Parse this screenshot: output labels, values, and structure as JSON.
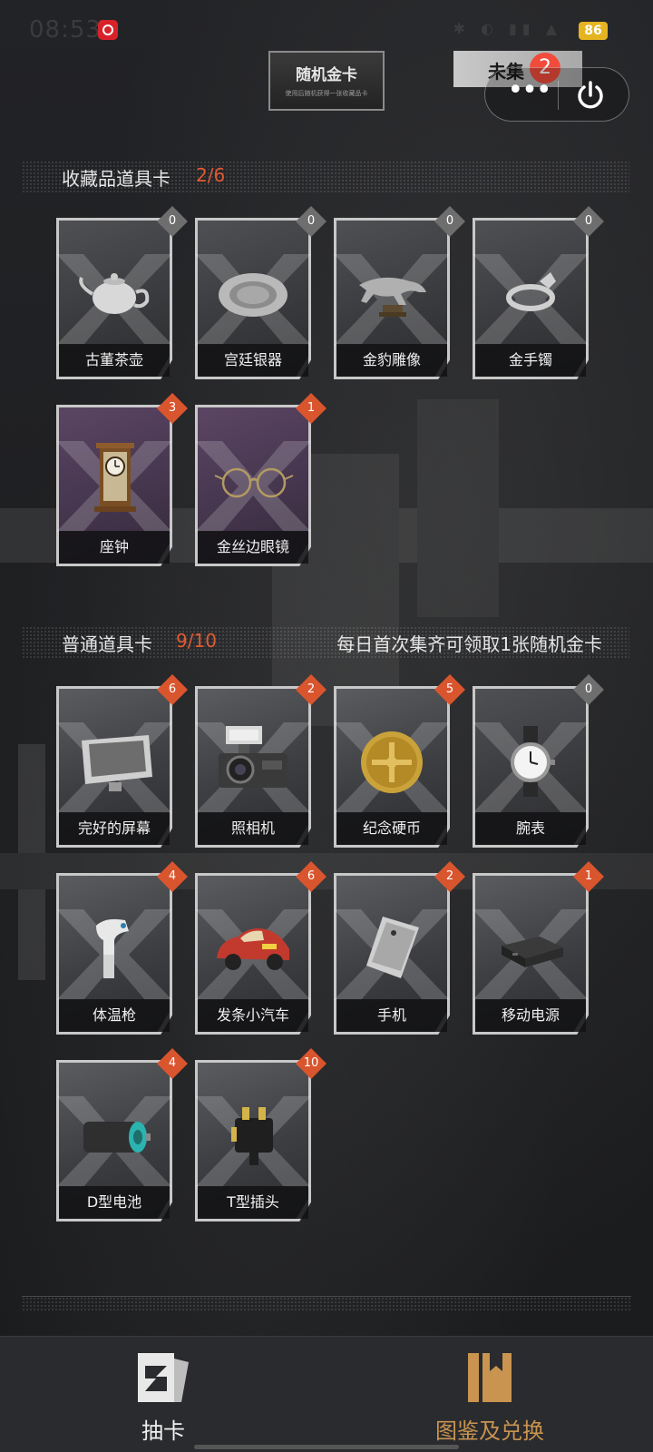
{
  "status_bar": {
    "time": "08:53",
    "battery": "86"
  },
  "top": {
    "gold_card_title": "随机金卡",
    "gold_card_subtitle": "使用后随机获得一张收藏品卡",
    "uncollected_tab": "未集",
    "uncollected_badge": "2"
  },
  "collectibles": {
    "title": "收藏品道具卡",
    "progress": "2/6",
    "cards": [
      {
        "name": "古董茶壶",
        "count": "0",
        "owned": false,
        "icon": "teapot-icon"
      },
      {
        "name": "宫廷银器",
        "count": "0",
        "owned": false,
        "icon": "silver-plate-icon"
      },
      {
        "name": "金豹雕像",
        "count": "0",
        "owned": false,
        "icon": "leopard-statue-icon"
      },
      {
        "name": "金手镯",
        "count": "0",
        "owned": false,
        "icon": "bracelet-icon"
      },
      {
        "name": "座钟",
        "count": "3",
        "owned": true,
        "icon": "mantel-clock-icon"
      },
      {
        "name": "金丝边眼镜",
        "count": "1",
        "owned": true,
        "icon": "glasses-icon"
      }
    ]
  },
  "normal": {
    "title": "普通道具卡",
    "progress": "9/10",
    "note": "每日首次集齐可领取1张随机金卡",
    "cards": [
      {
        "name": "完好的屏幕",
        "count": "6",
        "owned": true,
        "icon": "screen-icon"
      },
      {
        "name": "照相机",
        "count": "2",
        "owned": true,
        "icon": "camera-icon"
      },
      {
        "name": "纪念硬币",
        "count": "5",
        "owned": true,
        "icon": "coin-icon"
      },
      {
        "name": "腕表",
        "count": "0",
        "owned": false,
        "icon": "watch-icon"
      },
      {
        "name": "体温枪",
        "count": "4",
        "owned": true,
        "icon": "thermometer-gun-icon"
      },
      {
        "name": "发条小汽车",
        "count": "6",
        "owned": true,
        "icon": "toy-car-icon"
      },
      {
        "name": "手机",
        "count": "2",
        "owned": true,
        "icon": "phone-icon"
      },
      {
        "name": "移动电源",
        "count": "1",
        "owned": true,
        "icon": "power-bank-icon"
      },
      {
        "name": "D型电池",
        "count": "4",
        "owned": true,
        "icon": "battery-icon"
      },
      {
        "name": "T型插头",
        "count": "10",
        "owned": true,
        "icon": "plug-icon"
      }
    ]
  },
  "bottom_nav": {
    "draw_label": "抽卡",
    "album_label": "图鉴及兑换"
  },
  "colors": {
    "accent_orange": "#d9552e",
    "active_gold": "#c89450",
    "badge_red": "#f24b3b"
  }
}
